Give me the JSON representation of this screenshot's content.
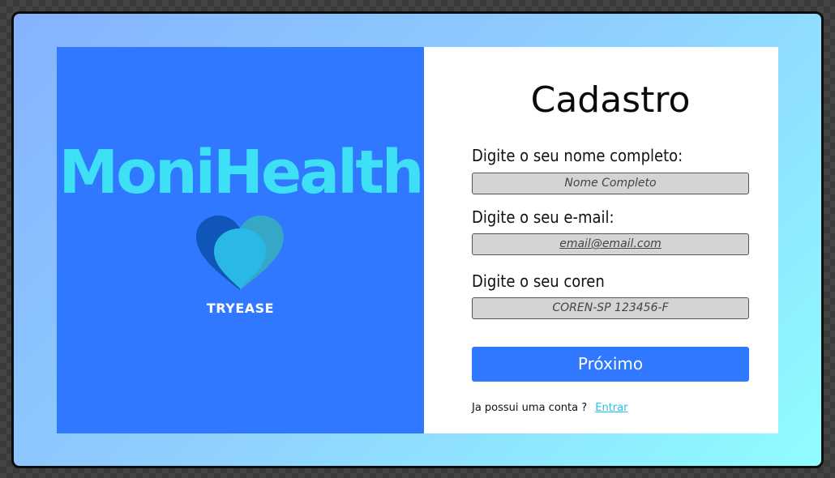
{
  "brand": {
    "name": "MoniHealth",
    "company": "TRYEASE",
    "logo_icon": "heart-icon",
    "panel_color": "#2f78ff",
    "name_color": "#3de0f5"
  },
  "form": {
    "title": "Cadastro",
    "fields": [
      {
        "label": "Digite o seu nome completo:",
        "placeholder": "Nome Completo"
      },
      {
        "label": "Digite o seu e-mail:",
        "placeholder": "email@email.com"
      },
      {
        "label": "Digite o seu coren",
        "placeholder": "COREN-SP 123456-F"
      }
    ],
    "next_label": "Próximo",
    "login_prompt": "Ja possui uma conta ?",
    "login_link": "Entrar",
    "accent_color": "#2f78ff",
    "link_color": "#20c4e8"
  }
}
